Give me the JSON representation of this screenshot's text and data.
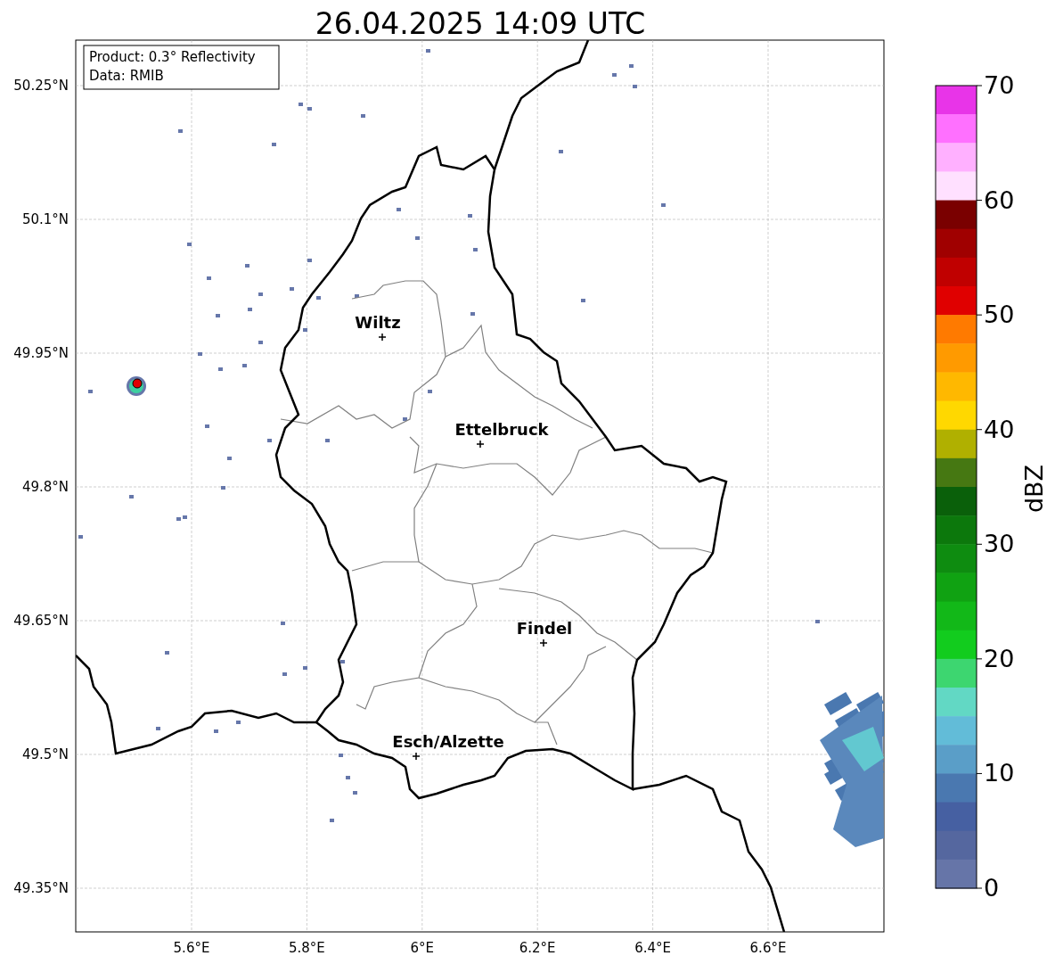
{
  "title": "26.04.2025 14:09 UTC",
  "info_box": [
    "Product: 0.3° Reflectivity",
    "Data: RMIB"
  ],
  "lat_labels": [
    "50.25°N",
    "50.1°N",
    "49.95°N",
    "49.8°N",
    "49.65°N",
    "49.5°N",
    "49.35°N"
  ],
  "lon_labels": [
    "5.6°E",
    "5.8°E",
    "6°E",
    "6.2°E",
    "6.4°E",
    "6.6°E"
  ],
  "cities": [
    {
      "name": "Wiltz"
    },
    {
      "name": "Ettelbruck"
    },
    {
      "name": "Findel"
    },
    {
      "name": "Esch/Alzette"
    }
  ],
  "colorbar": {
    "label": "dBZ",
    "ticks": [
      "70",
      "60",
      "50",
      "40",
      "30",
      "20",
      "10",
      "0"
    ],
    "bands": [
      {
        "color": "#e834e8"
      },
      {
        "color": "#ff70ff"
      },
      {
        "color": "#ffb0ff"
      },
      {
        "color": "#ffe0ff"
      },
      {
        "color": "#7a0000"
      },
      {
        "color": "#a00000"
      },
      {
        "color": "#c00000"
      },
      {
        "color": "#e00000"
      },
      {
        "color": "#ff7a00"
      },
      {
        "color": "#ff9a00"
      },
      {
        "color": "#ffb800"
      },
      {
        "color": "#ffd800"
      },
      {
        "color": "#b0b000"
      },
      {
        "color": "#467812"
      },
      {
        "color": "#0a600a"
      },
      {
        "color": "#0c780c"
      },
      {
        "color": "#0e8c10"
      },
      {
        "color": "#10a212"
      },
      {
        "color": "#12b818"
      },
      {
        "color": "#12cc1e"
      },
      {
        "color": "#3dd670"
      },
      {
        "color": "#62d8c4"
      },
      {
        "color": "#62bcd8"
      },
      {
        "color": "#5a9ec8"
      },
      {
        "color": "#4a78b0"
      },
      {
        "color": "#4660a2"
      },
      {
        "color": "#55679f"
      },
      {
        "color": "#6675a8"
      }
    ]
  }
}
